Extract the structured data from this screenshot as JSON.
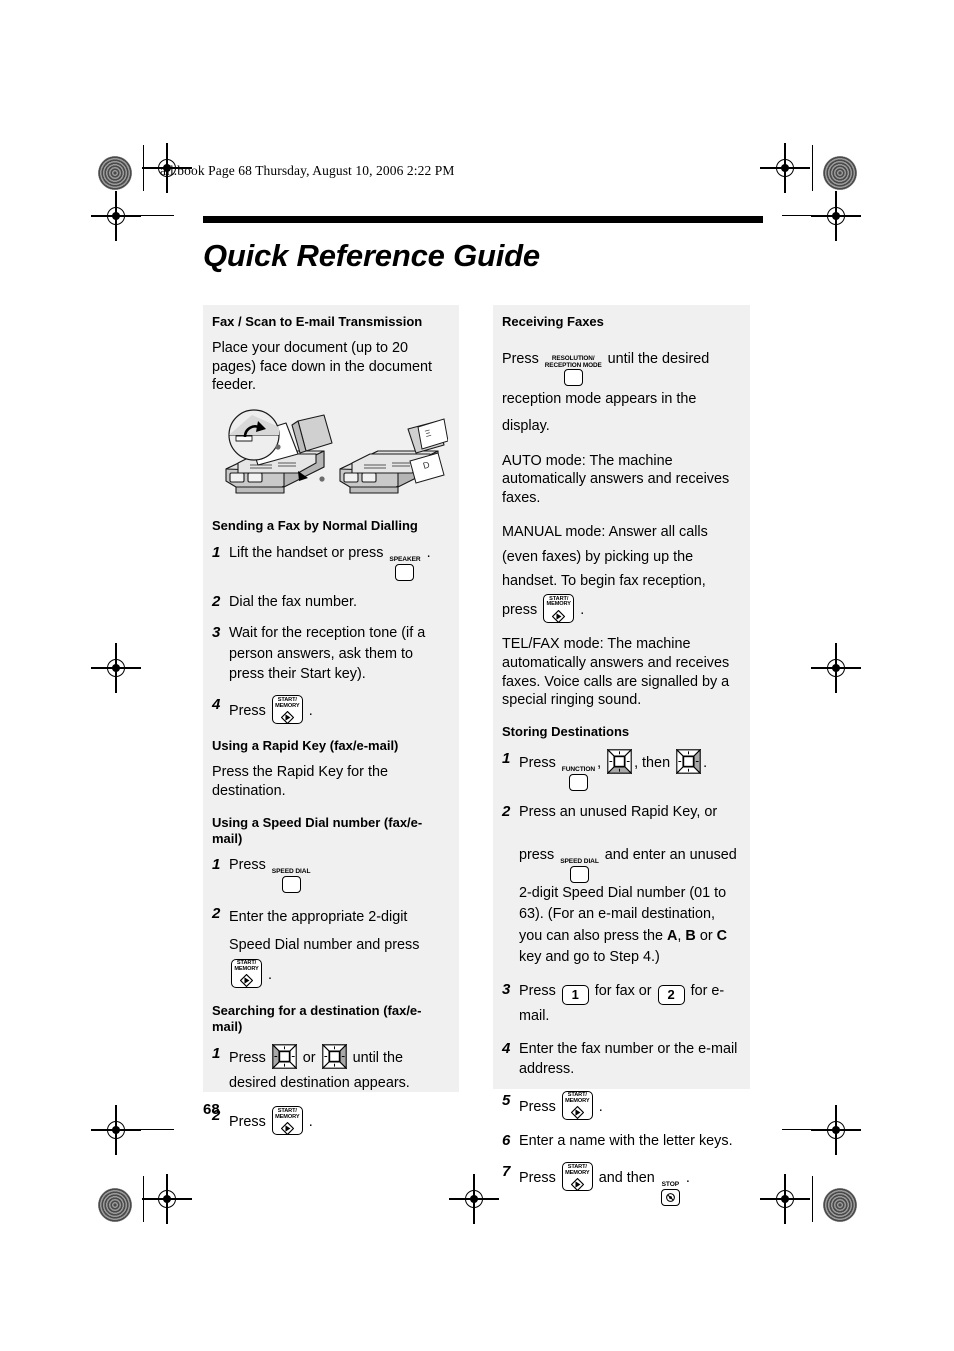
{
  "header": {
    "slug": "all.book  Page 68  Thursday, August 10, 2006  2:22 PM"
  },
  "page_title": "Quick Reference Guide",
  "page_number": "68",
  "keys": {
    "speaker": "SPEAKER",
    "speed_dial": "SPEED DIAL",
    "function": "FUNCTION",
    "resolution_line1": "RESOLUTION/",
    "resolution_line2": "RECEPTION MODE",
    "start_line1": "START/",
    "start_line2": "MEMORY",
    "stop": "STOP",
    "num_one": "1",
    "num_two": "2"
  },
  "left_column": {
    "sections": [
      {
        "heading": "Fax / Scan to E-mail Transmission",
        "intro": "Place your document (up to 20 pages) face down in the document feeder."
      },
      {
        "heading": "Sending a Fax by Normal Dialling",
        "steps": [
          {
            "num": "1",
            "before": "Lift the handset or press",
            "after": "."
          },
          {
            "num": "2",
            "before": "Dial the fax number.",
            "after": ""
          },
          {
            "num": "3",
            "before": "Wait for the reception tone (if a person answers, ask them to press their Start key).",
            "after": ""
          },
          {
            "num": "4",
            "before": "Press",
            "after": "."
          }
        ]
      },
      {
        "heading": "Using a Rapid Key (fax/e-mail)",
        "intro": "Press the Rapid Key for the destination."
      },
      {
        "heading": "Using a Speed Dial number (fax/e-mail)",
        "steps": [
          {
            "num": "1",
            "before": "Press",
            "after": ""
          },
          {
            "num": "2",
            "before": "Enter the appropriate 2-digit Speed Dial number and press",
            "after": "."
          }
        ]
      },
      {
        "heading": "Searching for a destination (fax/e-mail)",
        "steps": [
          {
            "num": "1",
            "before": "Press",
            "mid": "or",
            "after": "until the desired destination appears."
          },
          {
            "num": "2",
            "before": "Press",
            "after": "."
          }
        ]
      }
    ]
  },
  "right_column": {
    "sections": [
      {
        "heading": "Receiving Faxes",
        "press_before": "Press",
        "press_after": "until the desired reception mode appears in the display.",
        "modes": [
          "AUTO mode: The machine automatically answers and receives faxes.",
          "MANUAL mode: Answer all calls (even faxes) by picking up the handset. To begin fax reception, press",
          "TEL/FAX mode: The machine automatically answers and receives faxes. Voice calls are signalled by a special ringing sound."
        ],
        "manual_after": "."
      },
      {
        "heading": "Storing Destinations",
        "steps": [
          {
            "num": "1",
            "before": "Press",
            "mid1": ",",
            "mid2": ", then",
            "after": "."
          },
          {
            "num": "2",
            "line1": "Press an unused Rapid Key, or",
            "before": "press",
            "after": "and enter an unused 2-digit Speed Dial number (01 to 63). (For an e-mail destination, you can also press the",
            "bold_a": "A",
            "sep1": ",",
            "bold_b": "B",
            "sep2": "or",
            "bold_c": "C",
            "tail": "key and go to Step 4.)"
          },
          {
            "num": "3",
            "before": "Press",
            "mid": "for fax or",
            "after": "for e-mail."
          },
          {
            "num": "4",
            "before": "Enter the fax number or the e-mail address.",
            "after": ""
          },
          {
            "num": "5",
            "before": "Press",
            "after": "."
          },
          {
            "num": "6",
            "before": "Enter a name with the letter keys.",
            "after": ""
          },
          {
            "num": "7",
            "before": "Press",
            "mid": "and then",
            "after": "."
          }
        ]
      }
    ]
  }
}
